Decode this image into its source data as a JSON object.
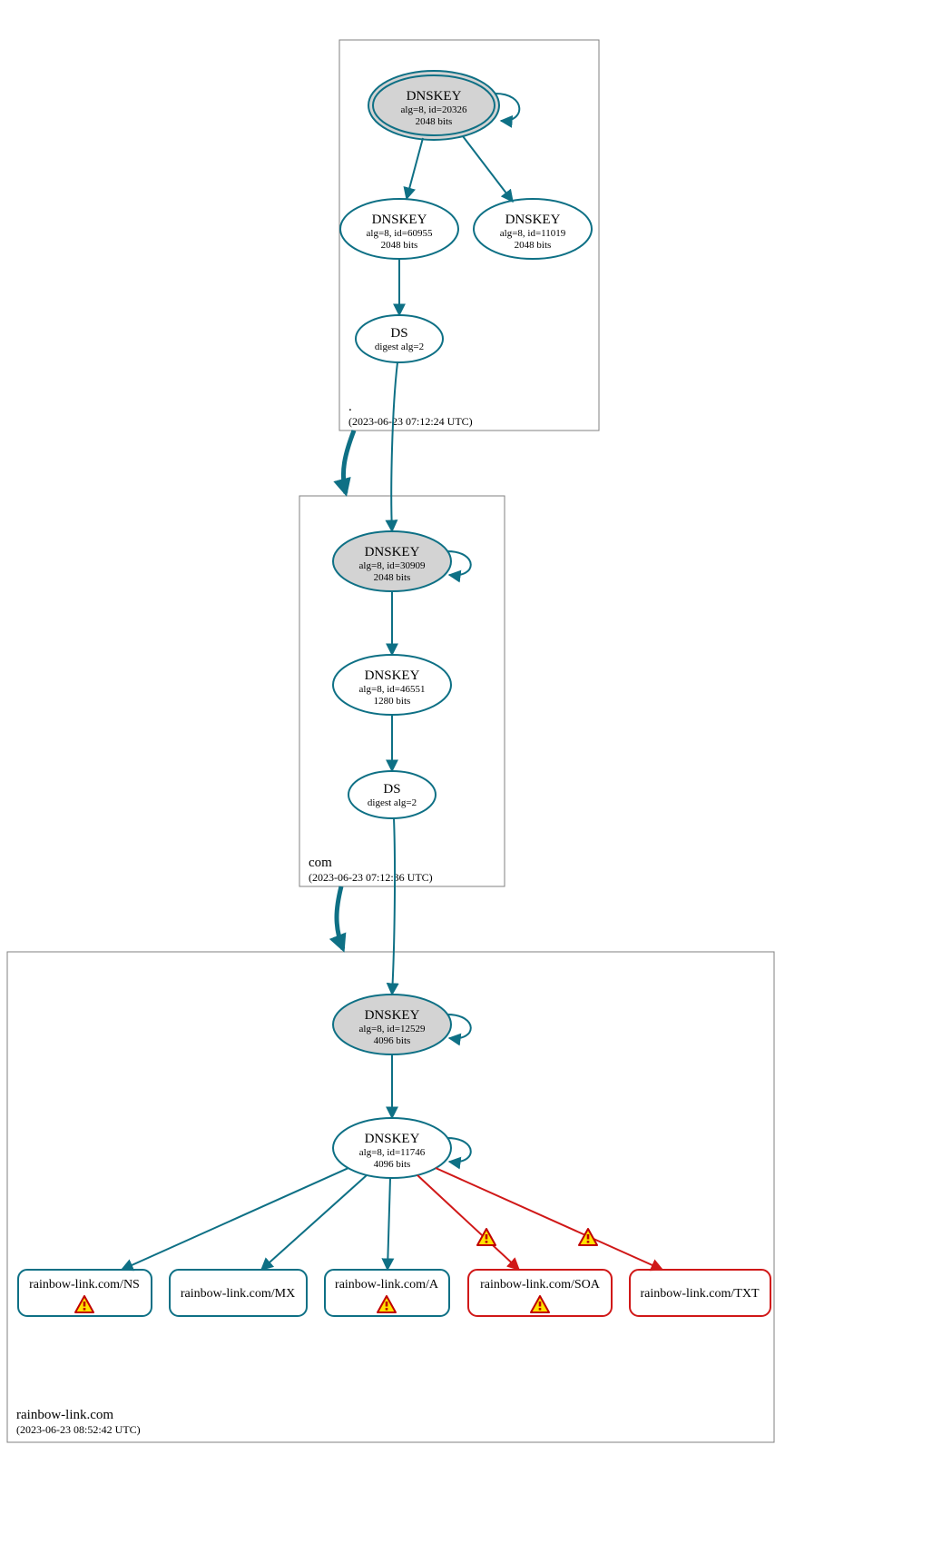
{
  "zones": {
    "root": {
      "name": ".",
      "timestamp": "(2023-06-23 07:12:24 UTC)"
    },
    "com": {
      "name": "com",
      "timestamp": "(2023-06-23 07:12:36 UTC)"
    },
    "domain": {
      "name": "rainbow-link.com",
      "timestamp": "(2023-06-23 08:52:42 UTC)"
    }
  },
  "nodes": {
    "root_ksk": {
      "title": "DNSKEY",
      "sub1": "alg=8, id=20326",
      "sub2": "2048 bits"
    },
    "root_zsk1": {
      "title": "DNSKEY",
      "sub1": "alg=8, id=60955",
      "sub2": "2048 bits"
    },
    "root_zsk2": {
      "title": "DNSKEY",
      "sub1": "alg=8, id=11019",
      "sub2": "2048 bits"
    },
    "root_ds": {
      "title": "DS",
      "sub1": "digest alg=2"
    },
    "com_ksk": {
      "title": "DNSKEY",
      "sub1": "alg=8, id=30909",
      "sub2": "2048 bits"
    },
    "com_zsk": {
      "title": "DNSKEY",
      "sub1": "alg=8, id=46551",
      "sub2": "1280 bits"
    },
    "com_ds": {
      "title": "DS",
      "sub1": "digest alg=2"
    },
    "dom_ksk": {
      "title": "DNSKEY",
      "sub1": "alg=8, id=12529",
      "sub2": "4096 bits"
    },
    "dom_zsk": {
      "title": "DNSKEY",
      "sub1": "alg=8, id=11746",
      "sub2": "4096 bits"
    }
  },
  "records": {
    "ns": "rainbow-link.com/NS",
    "mx": "rainbow-link.com/MX",
    "a": "rainbow-link.com/A",
    "soa": "rainbow-link.com/SOA",
    "txt": "rainbow-link.com/TXT"
  }
}
